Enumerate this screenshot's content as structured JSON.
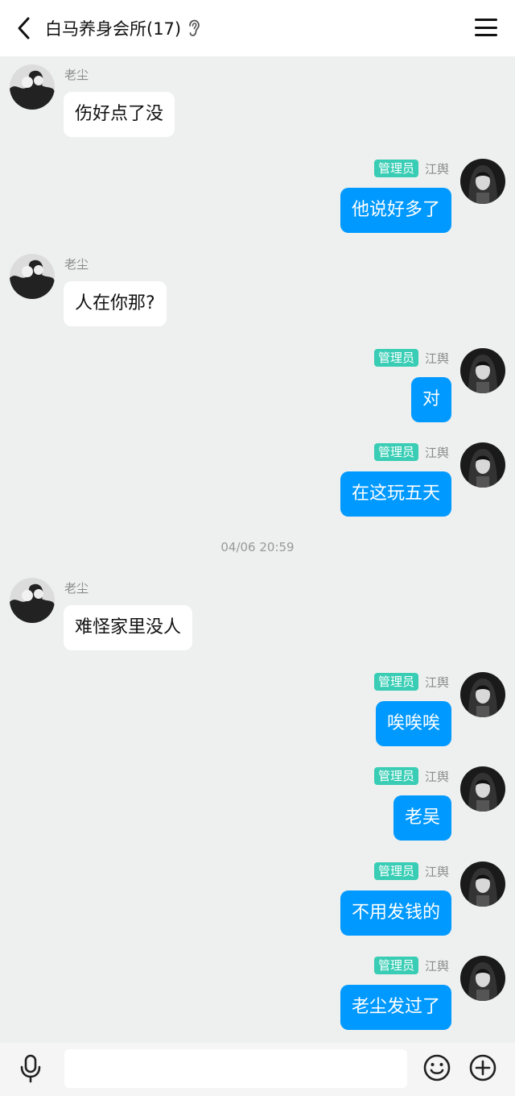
{
  "header": {
    "title": "白马养身会所(17)",
    "back_icon": "chevron-left-icon",
    "ear_icon": "ear-icon",
    "menu_icon": "hamburger-menu-icon"
  },
  "messages": [
    {
      "side": "left",
      "sender": "老尘",
      "text": "伤好点了没"
    },
    {
      "side": "right",
      "badge": "管理员",
      "sender": "江舆",
      "text": "他说好多了"
    },
    {
      "side": "left",
      "sender": "老尘",
      "text": "人在你那?"
    },
    {
      "side": "right",
      "badge": "管理员",
      "sender": "江舆",
      "text": "对"
    },
    {
      "side": "right",
      "badge": "管理员",
      "sender": "江舆",
      "text": "在这玩五天"
    },
    {
      "type": "time",
      "text": "04/06 20:59"
    },
    {
      "side": "left",
      "sender": "老尘",
      "text": "难怪家里没人"
    },
    {
      "side": "right",
      "badge": "管理员",
      "sender": "江舆",
      "text": "唉唉唉"
    },
    {
      "side": "right",
      "badge": "管理员",
      "sender": "江舆",
      "text": "老吴"
    },
    {
      "side": "right",
      "badge": "管理员",
      "sender": "江舆",
      "text": "不用发钱的"
    },
    {
      "side": "right",
      "badge": "管理员",
      "sender": "江舆",
      "text": "老尘发过了"
    }
  ],
  "input_bar": {
    "mic_icon": "microphone-icon",
    "input_value": "",
    "input_placeholder": "",
    "emoji_icon": "emoji-icon",
    "plus_icon": "plus-circle-icon"
  },
  "colors": {
    "background": "#edf0ee",
    "bubble_self": "#0099ff",
    "bubble_other": "#ffffff",
    "admin_badge": "#38cdb4"
  }
}
